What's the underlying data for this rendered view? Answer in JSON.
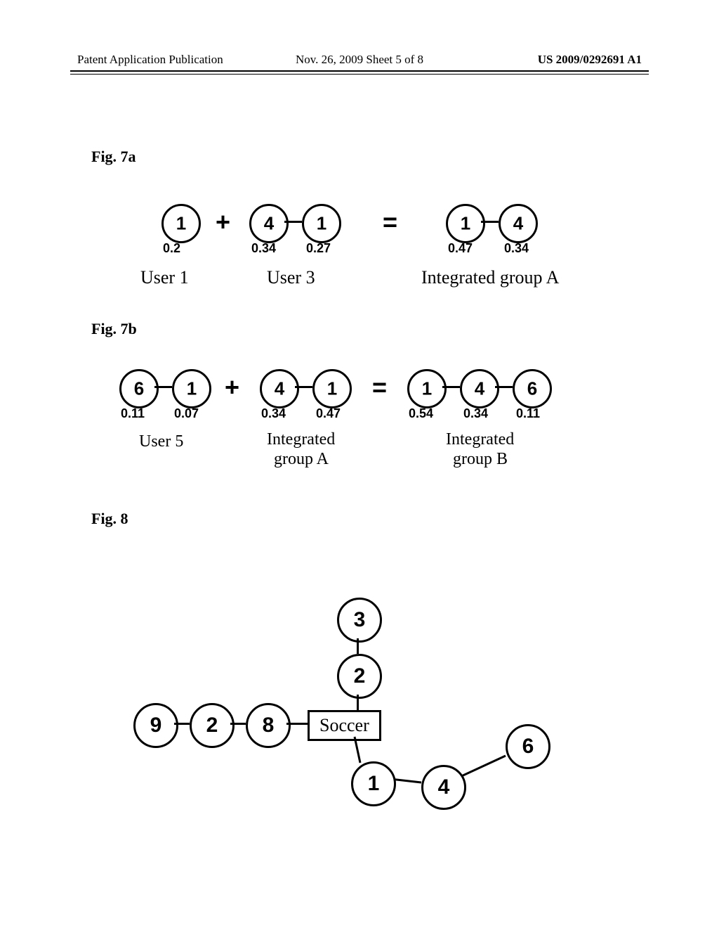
{
  "header": {
    "left": "Patent Application Publication",
    "center": "Nov. 26, 2009  Sheet 5 of 8",
    "right": "US 2009/0292691 A1"
  },
  "fig7a": {
    "label": "Fig. 7a",
    "user1": {
      "node": "1",
      "val": "0.2",
      "caption": "User 1"
    },
    "plus": "+",
    "user3": {
      "nodeL": "4",
      "valL": "0.34",
      "nodeR": "1",
      "valR": "0.27",
      "caption": "User 3"
    },
    "eq": "=",
    "groupA": {
      "nodeL": "1",
      "valL": "0.47",
      "nodeR": "4",
      "valR": "0.34",
      "caption": "Integrated group A"
    }
  },
  "fig7b": {
    "label": "Fig. 7b",
    "user5": {
      "nodeL": "6",
      "valL": "0.11",
      "nodeR": "1",
      "valR": "0.07",
      "caption": "User 5"
    },
    "plus": "+",
    "groupA": {
      "nodeL": "4",
      "valL": "0.34",
      "nodeR": "1",
      "valR": "0.47",
      "caption1": "Integrated",
      "caption2": "group A"
    },
    "eq": "=",
    "groupB": {
      "node1": "1",
      "val1": "0.54",
      "node2": "4",
      "val2": "0.34",
      "node3": "6",
      "val3": "0.11",
      "caption1": "Integrated",
      "caption2": "group B"
    }
  },
  "fig8": {
    "label": "Fig. 8",
    "n3": "3",
    "n2top": "2",
    "n9": "9",
    "n2left": "2",
    "n8": "8",
    "box": "Soccer",
    "n1": "1",
    "n4": "4",
    "n6": "6"
  }
}
